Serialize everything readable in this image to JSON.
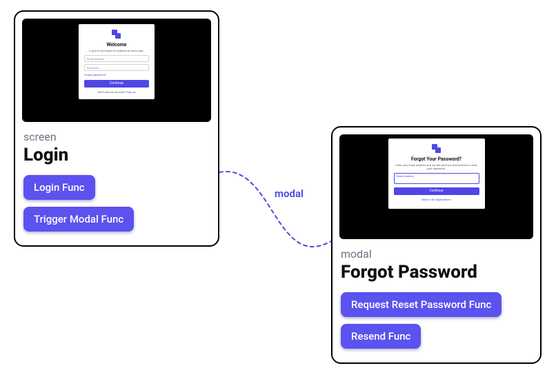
{
  "login_card": {
    "type_label": "screen",
    "title": "Login",
    "buttons": {
      "login_func": "Login Func",
      "trigger_modal_func": "Trigger Modal Func"
    },
    "thumb": {
      "heading": "Welcome",
      "subtitle": "Log in to try-tenant to continue to Acme App.",
      "email_label": "Email address",
      "password_label": "Password",
      "forgot_link": "Forgot password?",
      "continue_label": "Continue",
      "footer_text": "Don't have an account?",
      "footer_link": "Sign up"
    }
  },
  "forgot_card": {
    "type_label": "modal",
    "title": "Forgot Password",
    "buttons": {
      "request_reset": "Request Reset Password Func",
      "resend": "Resend Func"
    },
    "thumb": {
      "heading": "Forgot Your Password?",
      "subtitle": "Enter your email address and we will send you instructions to reset your password.",
      "email_label": "Email address",
      "continue_label": "Continue",
      "back_link": "Back to All Applications"
    }
  },
  "connector_label": "modal"
}
